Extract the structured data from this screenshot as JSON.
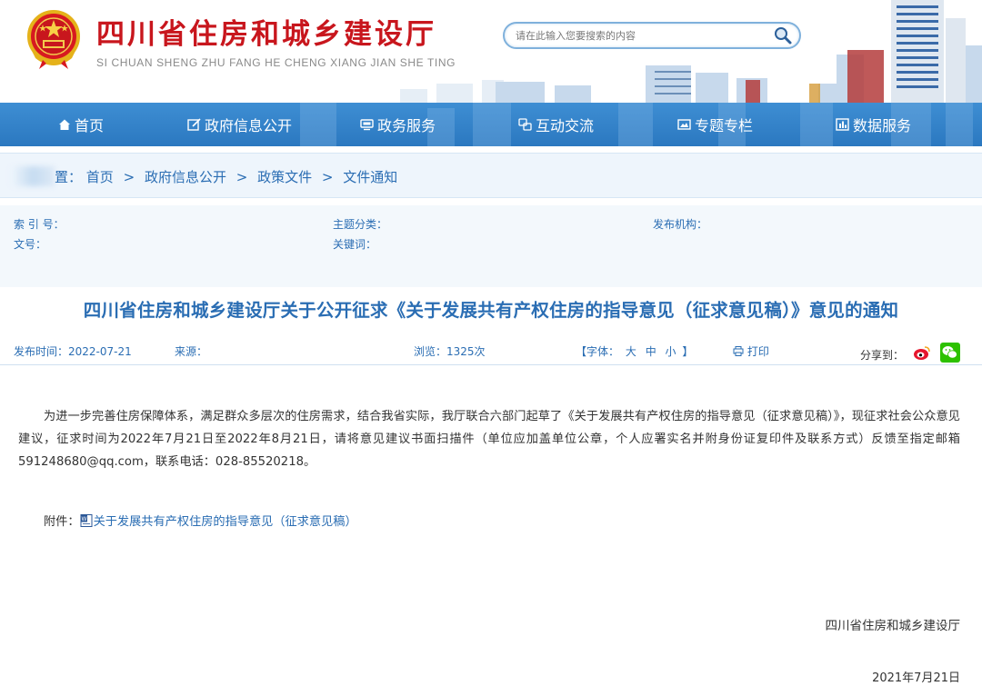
{
  "header": {
    "title": "四川省住房和城乡建设厅",
    "subtitle": "SI CHUAN SHENG ZHU FANG HE CHENG XIANG JIAN SHE TING",
    "search_placeholder": "请在此输入您要搜索的内容"
  },
  "nav": {
    "items": [
      {
        "label": "首页",
        "icon": "home-icon"
      },
      {
        "label": "政府信息公开",
        "icon": "edit-icon"
      },
      {
        "label": "政务服务",
        "icon": "monitor-icon"
      },
      {
        "label": "互动交流",
        "icon": "exchange-icon"
      },
      {
        "label": "专题专栏",
        "icon": "image-icon"
      },
      {
        "label": "数据服务",
        "icon": "chart-icon"
      }
    ]
  },
  "breadcrumb": {
    "prefix": "置：",
    "items": [
      "首页",
      "政府信息公开",
      "政策文件",
      "文件通知"
    ],
    "separator": ">"
  },
  "meta": {
    "index_label": "索 引 号：",
    "topic_label": "主题分类：",
    "publisher_label": "发布机构：",
    "doc_no_label": "文号：",
    "keywords_label": "关键词："
  },
  "article": {
    "title": "四川省住房和城乡建设厅关于公开征求《关于发展共有产权住房的指导意见（征求意见稿）》意见的通知",
    "publish_time": "发布时间：2022-07-21",
    "source": "来源：",
    "views": "浏览：1325次",
    "font_label_open": "【字体：",
    "font_large": "大",
    "font_medium": "中",
    "font_small": "小",
    "font_label_close": "】",
    "print_label": "打印",
    "share_label": "分享到：",
    "body_paragraph": "为进一步完善住房保障体系，满足群众多层次的住房需求，结合我省实际，我厅联合六部门起草了《关于发展共有产权住房的指导意见（征求意见稿）》，现征求社会公众意见建议，征求时间为2022年7月21日至2022年8月21日，请将意见建议书面扫描件（单位应加盖单位公章，个人应署实名并附身份证复印件及联系方式）反馈至指定邮箱591248680@qq.com，联系电话：028-85520218。",
    "attachment_label": "附件：",
    "attachment_link": "关于发展共有产权住房的指导意见（征求意见稿）",
    "signature": "四川省住房和城乡建设厅",
    "sign_date": "2021年7月21日"
  },
  "colors": {
    "brand_red": "#c8161d",
    "nav_blue": "#3483c9",
    "link_blue": "#2a6db3"
  }
}
